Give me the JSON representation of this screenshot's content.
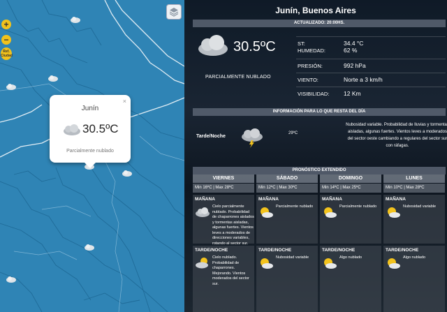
{
  "map": {
    "zoom_in_label": "+",
    "zoom_out_label": "−",
    "location_button_label": "Ref. Ciudad",
    "layers_icon": "layers-icon",
    "popup": {
      "close_label": "×",
      "city": "Junín",
      "temperature": "30.5ºC",
      "description": "Parcialmente nublado",
      "icon": "partly-cloudy-icon"
    }
  },
  "header": {
    "city_title": "Junín, Buenos Aires",
    "updated_label": "ACTUALIZADO: 20:00HS."
  },
  "current": {
    "icon": "cloud-icon",
    "temperature": "30.5ºC",
    "description": "PARCIALMENTE NUBLADO",
    "details": [
      {
        "label": "ST:",
        "value": "34.4 °C"
      },
      {
        "label": "HUMEDAD:",
        "value": "62 %"
      },
      {
        "label": "PRESIÓN:",
        "value": "992 hPa"
      },
      {
        "label": "VIENTO:",
        "value": "Norte a 3 km/h"
      },
      {
        "label": "VISIBILIDAD:",
        "value": "12 Km"
      }
    ]
  },
  "rest_of_day": {
    "bar_label": "INFORMACIÓN PARA LO QUE RESTA DEL DÍA",
    "period": "Tarde/Noche",
    "icon": "storm-cloud-icon",
    "temperature": "29ºC",
    "text": "Nubosidad variable. Probabilidad de lluvias y tormentas aisladas, algunas fuertes. Vientos leves a moderados del sector oeste cambiando a regulares del sector sur con ráfagas."
  },
  "extended": {
    "bar_label": "PRONÓSTICO EXTENDIDO",
    "days": [
      {
        "name": "VIERNES",
        "range": "Min 16ºC | Max 28ºC",
        "morning_label": "MAÑANA",
        "morning_icon": "cloud-icon",
        "morning_text": "Cielo parcialmente nublado. Probabilidad de chaparrones aislados y tormentas aisladas, algunas fuertes. Vientos leves a moderados de direcciones variables, rotando al sector sur.",
        "night_label": "TARDE/NOCHE",
        "night_icon": "partly-cloudy-icon",
        "night_text": "Cielo nublado. Probabilidad de chaparrones. Mejorando. Vientos moderados del sector sur."
      },
      {
        "name": "SÁBADO",
        "range": "Min 12ºC | Max 30ºC",
        "morning_label": "MAÑANA",
        "morning_icon": "partly-sunny-icon",
        "morning_text": "Parcialmente nublado",
        "night_label": "TARDE/NOCHE",
        "night_icon": "partly-sunny-icon",
        "night_text": "Nubosidad variable"
      },
      {
        "name": "DOMINGO",
        "range": "Min 14ºC | Max 25ºC",
        "morning_label": "MAÑANA",
        "morning_icon": "partly-sunny-icon",
        "morning_text": "Parcialmente nublado",
        "night_label": "TARDE/NOCHE",
        "night_icon": "partly-sunny-icon",
        "night_text": "Algo nublado"
      },
      {
        "name": "LUNES",
        "range": "Min 10ºC | Max 28ºC",
        "morning_label": "MAÑANA",
        "morning_icon": "partly-sunny-icon",
        "morning_text": "Nubosidad variable",
        "night_label": "TARDE/NOCHE",
        "night_icon": "partly-sunny-icon",
        "night_text": "Algo nublado"
      }
    ]
  },
  "colors": {
    "map_water": "#2f84b5",
    "map_controls": "#f1c21b",
    "panel_bar": "#5a6473"
  }
}
